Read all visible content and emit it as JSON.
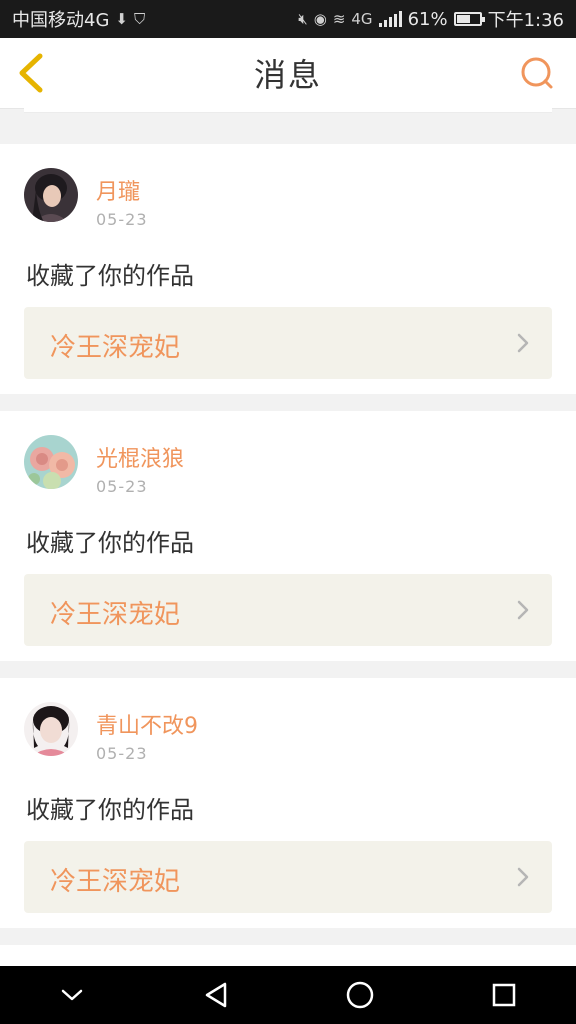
{
  "status_bar": {
    "carrier": "中国移动4G",
    "battery_text": "61%",
    "battery_level": 0.61,
    "time": "下午1:36",
    "network": "4G"
  },
  "nav": {
    "title": "消息",
    "back_icon": "chevron-left-icon",
    "search_icon": "search-icon"
  },
  "colors": {
    "accent": "#f0955c",
    "back_icon": "#e6b400",
    "link_bg": "#f3f2ea"
  },
  "messages": [
    {
      "username": "月瓏",
      "date": "05-23",
      "action": "收藏了你的作品",
      "work_title": "冷王深宠妃"
    },
    {
      "username": "光棍浪狼",
      "date": "05-23",
      "action": "收藏了你的作品",
      "work_title": "冷王深宠妃"
    },
    {
      "username": "青山不改9",
      "date": "05-23",
      "action": "收藏了你的作品",
      "work_title": "冷王深宠妃"
    }
  ],
  "system_nav": {
    "icons": [
      "chevron-down-icon",
      "back-triangle-icon",
      "home-circle-icon",
      "recents-square-icon"
    ]
  }
}
